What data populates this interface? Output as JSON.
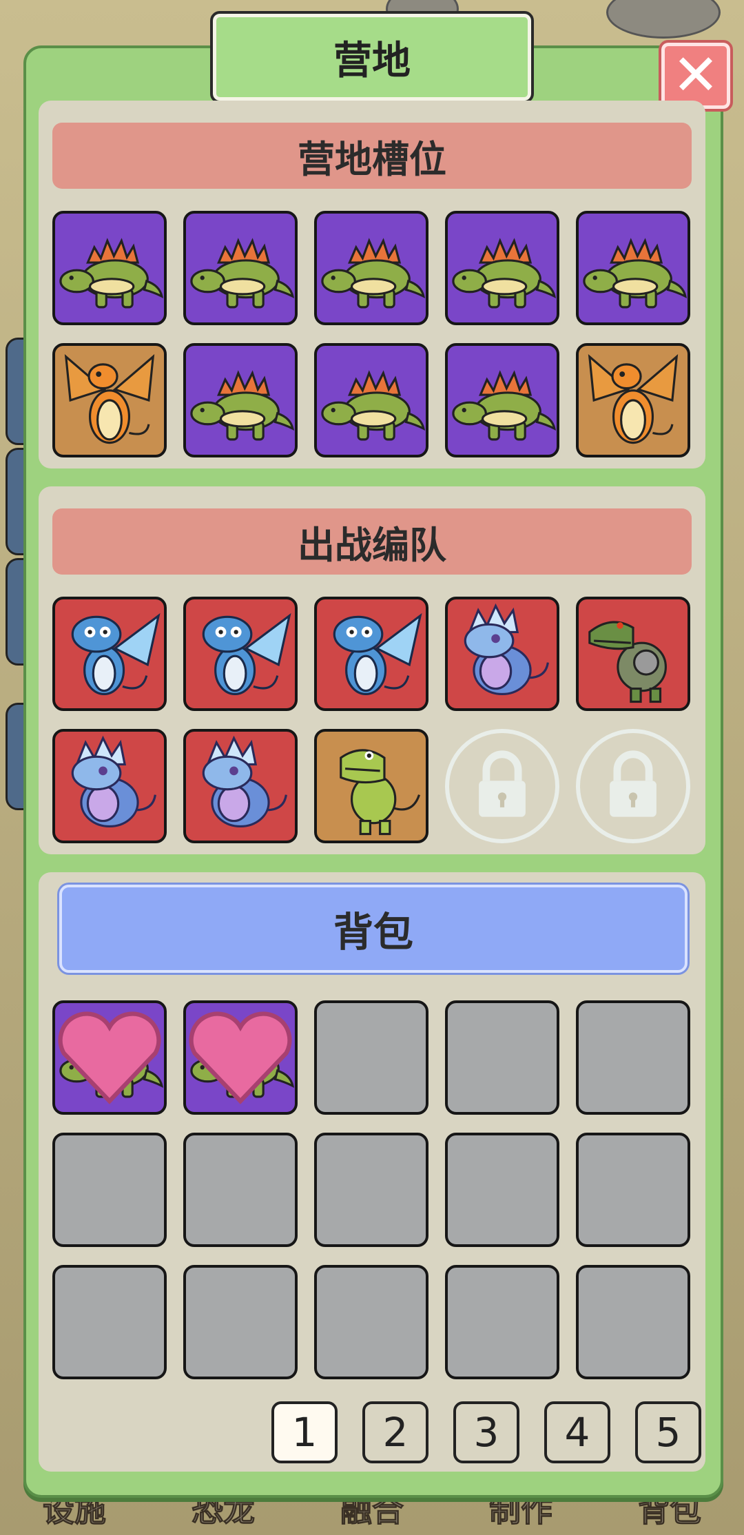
{
  "window": {
    "title": "营地"
  },
  "close_icon": "close-icon",
  "sections": {
    "camp": {
      "title": "营地槽位"
    },
    "team": {
      "title": "出战编队"
    },
    "bag": {
      "title": "背包"
    }
  },
  "camp_slots": [
    {
      "creature": "stegosaurus",
      "bg": "purple"
    },
    {
      "creature": "stegosaurus",
      "bg": "purple"
    },
    {
      "creature": "stegosaurus",
      "bg": "purple"
    },
    {
      "creature": "stegosaurus",
      "bg": "purple"
    },
    {
      "creature": "stegosaurus",
      "bg": "purple"
    },
    {
      "creature": "orange-dragon",
      "bg": "orange"
    },
    {
      "creature": "stegosaurus",
      "bg": "purple"
    },
    {
      "creature": "stegosaurus",
      "bg": "purple"
    },
    {
      "creature": "stegosaurus",
      "bg": "purple"
    },
    {
      "creature": "orange-dragon",
      "bg": "orange"
    }
  ],
  "team_slots": [
    {
      "creature": "ice-dragon",
      "bg": "red"
    },
    {
      "creature": "ice-dragon",
      "bg": "red"
    },
    {
      "creature": "ice-dragon",
      "bg": "red"
    },
    {
      "creature": "crystal-dino",
      "bg": "red"
    },
    {
      "creature": "mecha-trex",
      "bg": "red"
    },
    {
      "creature": "crystal-dino",
      "bg": "red"
    },
    {
      "creature": "crystal-dino",
      "bg": "red"
    },
    {
      "creature": "green-trex",
      "bg": "orange"
    },
    {
      "creature": "lock-icon",
      "bg": "locked"
    },
    {
      "creature": "lock-icon",
      "bg": "locked"
    }
  ],
  "bag_slots": [
    {
      "creature": "stegosaurus",
      "bg": "purple",
      "favorite": true
    },
    {
      "creature": "stegosaurus",
      "bg": "purple",
      "favorite": true
    },
    {
      "creature": "",
      "bg": "empty"
    },
    {
      "creature": "",
      "bg": "empty"
    },
    {
      "creature": "",
      "bg": "empty"
    },
    {
      "creature": "",
      "bg": "empty"
    },
    {
      "creature": "",
      "bg": "empty"
    },
    {
      "creature": "",
      "bg": "empty"
    },
    {
      "creature": "",
      "bg": "empty"
    },
    {
      "creature": "",
      "bg": "empty"
    },
    {
      "creature": "",
      "bg": "empty"
    },
    {
      "creature": "",
      "bg": "empty"
    },
    {
      "creature": "",
      "bg": "empty"
    },
    {
      "creature": "",
      "bg": "empty"
    },
    {
      "creature": "",
      "bg": "empty"
    }
  ],
  "pagination": {
    "pages": [
      "1",
      "2",
      "3",
      "4",
      "5"
    ],
    "current": "1"
  },
  "bottom_nav": [
    "设施",
    "恐龙",
    "融合",
    "制作",
    "背包"
  ],
  "colors": {
    "panel": "#9ed27f",
    "section": "#d9d5c2",
    "header_red": "#e0968a",
    "header_blue": "#8fa9f6",
    "slot_purple": "#7a46c8",
    "slot_red": "#cf4747",
    "slot_orange": "#c88f4f",
    "slot_empty": "#a7a9aa"
  }
}
